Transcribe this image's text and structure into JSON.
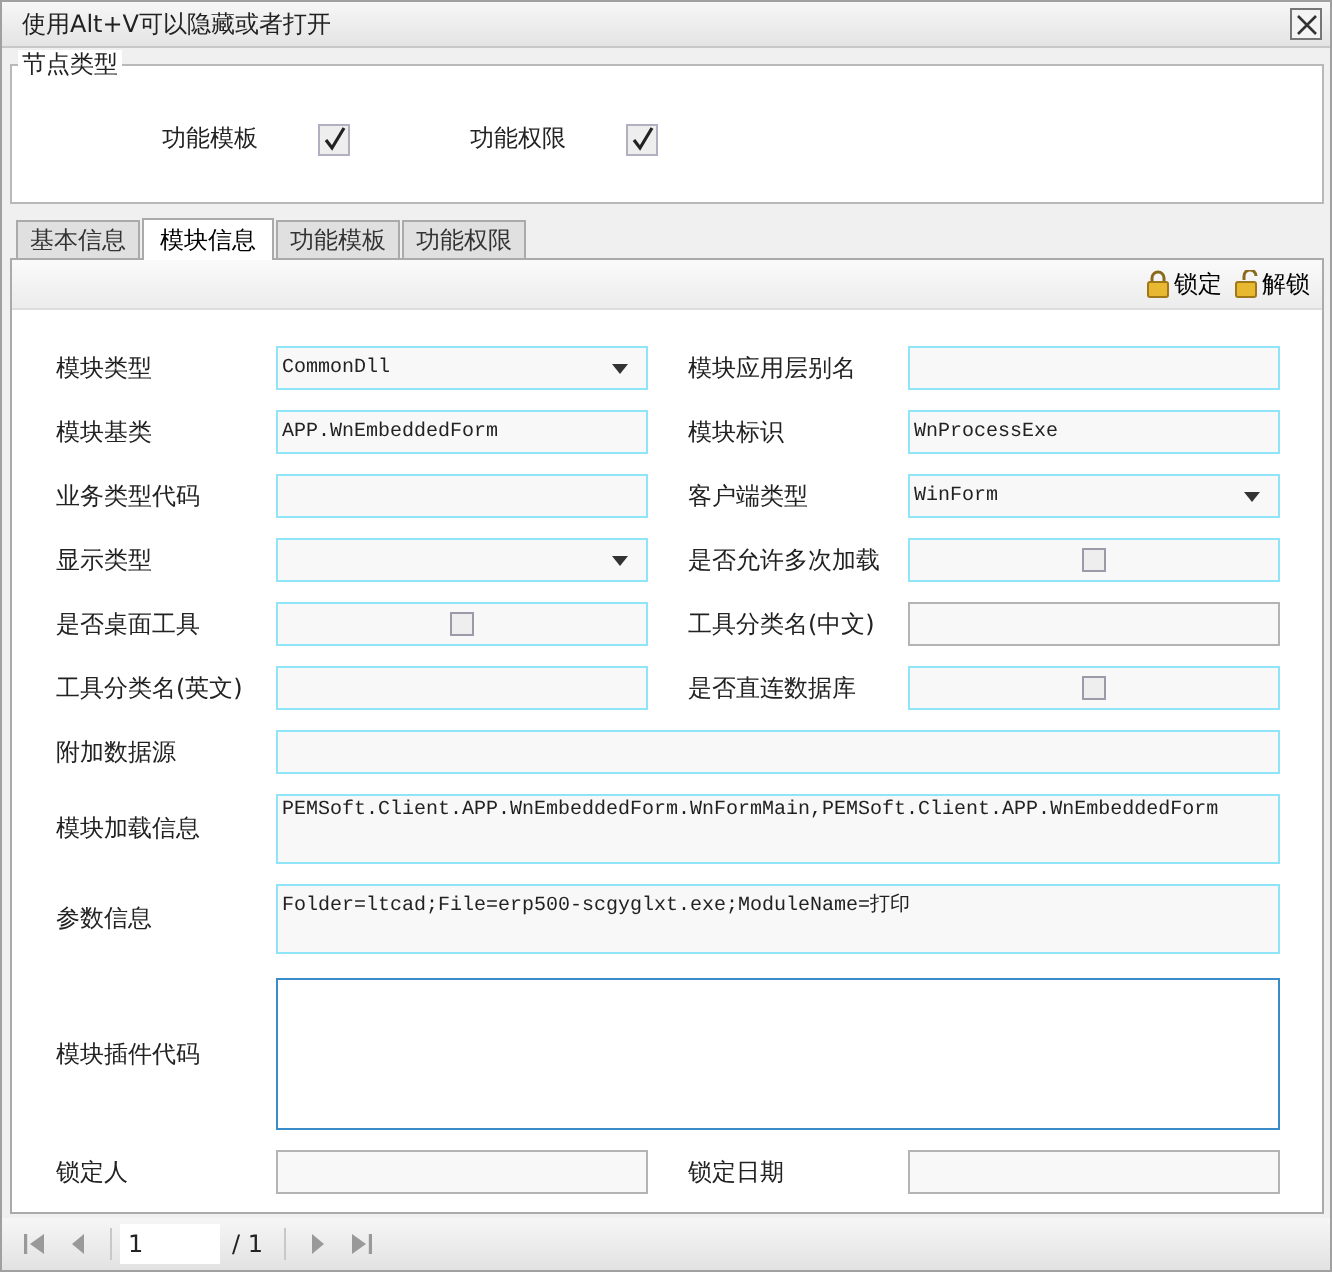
{
  "window": {
    "title": "使用Alt+V可以隐藏或者打开"
  },
  "node_type": {
    "title": "节点类型",
    "options": [
      {
        "label": "功能模板",
        "checked": true
      },
      {
        "label": "功能权限",
        "checked": true
      }
    ]
  },
  "tabs": [
    {
      "label": "基本信息",
      "selected": false
    },
    {
      "label": "模块信息",
      "selected": true
    },
    {
      "label": "功能模板",
      "selected": false
    },
    {
      "label": "功能权限",
      "selected": false
    }
  ],
  "toolbar": [
    {
      "kind": "lock",
      "label": "锁定"
    },
    {
      "kind": "unlock",
      "label": "解锁"
    }
  ],
  "rows": [
    [
      {
        "label": "模块类型",
        "kind": "combo",
        "value": "CommonDll",
        "highlighted": true
      },
      {
        "label": "模块应用层别名",
        "kind": "text",
        "highlighted": true
      }
    ],
    [
      {
        "label": "模块基类",
        "kind": "text",
        "value": "APP.WnEmbeddedForm",
        "highlighted": true
      },
      {
        "label": "模块标识",
        "kind": "text",
        "value": "WnProcessExe",
        "highlighted": true
      }
    ],
    [
      {
        "label": "业务类型代码",
        "kind": "text",
        "highlighted": true
      },
      {
        "label": "客户端类型",
        "kind": "combo",
        "value": "WinForm",
        "highlighted": true
      }
    ],
    [
      {
        "label": "显示类型",
        "kind": "combo",
        "highlighted": true
      },
      {
        "label": "是否允许多次加载",
        "kind": "check",
        "checked": false,
        "highlighted": true
      }
    ],
    [
      {
        "label": "是否桌面工具",
        "kind": "check",
        "checked": false,
        "highlighted": true
      },
      {
        "label": "工具分类名(中文)",
        "kind": "text",
        "highlighted": false
      }
    ],
    [
      {
        "label": "工具分类名(英文)",
        "kind": "text",
        "highlighted": true
      },
      {
        "label": "是否直连数据库",
        "kind": "check",
        "checked": false,
        "highlighted": true
      }
    ],
    [
      {
        "label": "附加数据源",
        "kind": "text",
        "highlighted": true
      }
    ],
    [
      {
        "label": "模块加载信息",
        "kind": "memo",
        "value": "PEMSoft.Client.APP.WnEmbeddedForm.WnFormMain,PEMSoft.Client.APP.WnEmbeddedForm",
        "highlighted": true
      }
    ],
    [
      {
        "label": "参数信息",
        "kind": "memo",
        "value": "Folder=ltcad;File=erp500-scgyglxt.exe;ModuleName=打印",
        "highlighted": true
      }
    ],
    [
      {
        "label": "模块插件代码",
        "kind": "editor",
        "focused": true
      }
    ],
    [
      {
        "label": "锁定人",
        "kind": "text",
        "highlighted": false
      },
      {
        "label": "锁定日期",
        "kind": "text",
        "highlighted": false
      }
    ]
  ],
  "pager": {
    "page": "1",
    "total": "/ 1"
  }
}
